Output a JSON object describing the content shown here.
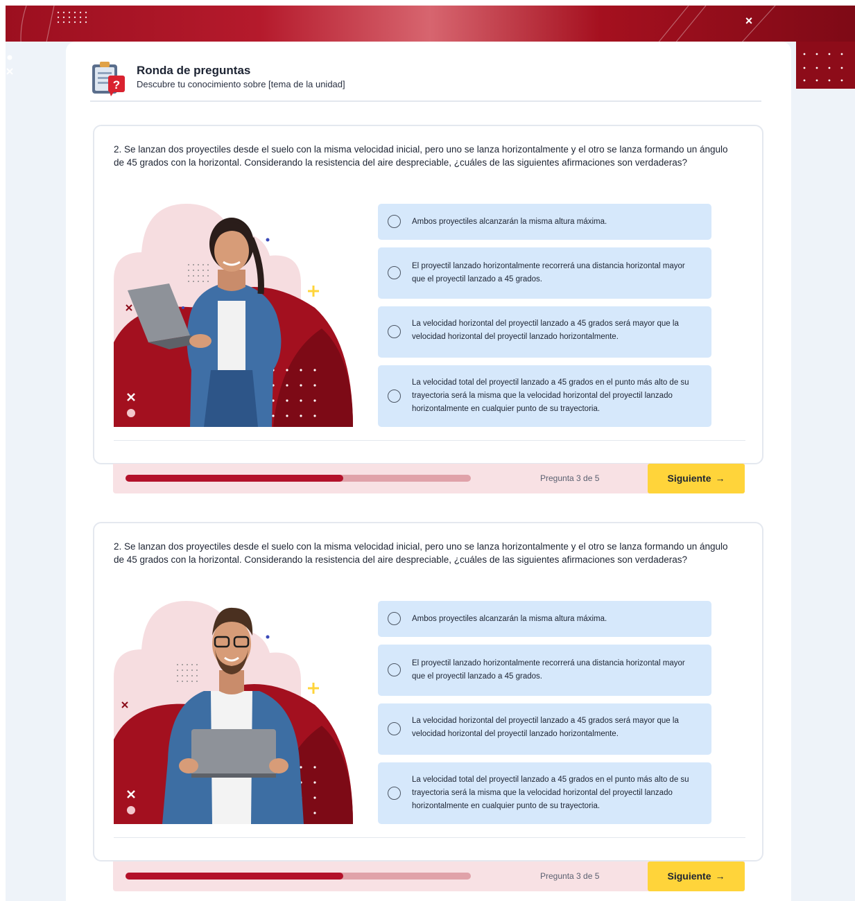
{
  "header": {
    "title": "Ronda de preguntas",
    "subtitle": "Descubre tu conocimiento sobre [tema de la unidad]"
  },
  "questions": [
    {
      "text": "2. Se lanzan dos proyectiles desde el suelo con la misma velocidad inicial, pero uno se lanza horizontalmente y el otro se lanza formando un ángulo de 45 grados con la horizontal. Considerando la resistencia del aire despreciable, ¿cuáles de las siguientes afirmaciones son verdaderas?",
      "options": [
        "Ambos proyectiles alcanzarán la misma altura máxima.",
        "El proyectil lanzado horizontalmente recorrerá una distancia horizontal mayor que el proyectil lanzado a 45 grados.",
        "La velocidad horizontal del proyectil lanzado a 45 grados será mayor que la velocidad horizontal del proyectil lanzado horizontalmente.",
        "La velocidad total del proyectil lanzado a 45 grados en el punto más alto de su trayectoria será la misma que la velocidad horizontal del proyectil lanzado horizontalmente en cualquier punto de su trayectoria."
      ],
      "progress_label": "Pregunta 3 de 5",
      "progress_fraction": 0.63,
      "next_label": "Siguiente",
      "next_arrow": "→"
    },
    {
      "text": "2. Se lanzan dos proyectiles desde el suelo con la misma velocidad inicial, pero uno se lanza horizontalmente y el otro se lanza formando un ángulo de 45 grados con la horizontal. Considerando la resistencia del aire despreciable, ¿cuáles de las siguientes afirmaciones son verdaderas?",
      "options": [
        "Ambos proyectiles alcanzarán la misma altura máxima.",
        "El proyectil lanzado horizontalmente recorrerá una distancia horizontal mayor que el proyectil lanzado a 45 grados.",
        "La velocidad horizontal del proyectil lanzado a 45 grados será mayor que la velocidad horizontal del proyectil lanzado horizontalmente.",
        "La velocidad total del proyectil lanzado a 45 grados en el punto más alto de su trayectoria será la misma que la velocidad horizontal del proyectil lanzado horizontalmente en cualquier punto de su trayectoria."
      ],
      "progress_label": "Pregunta 3 de 5",
      "progress_fraction": 0.63,
      "next_label": "Siguiente",
      "next_arrow": "→"
    }
  ],
  "colors": {
    "brand_red": "#b3112a",
    "option_bg": "#d6e8fb",
    "next_button": "#ffd43a",
    "footer_bg": "#f8e1e4"
  },
  "icons": {
    "banner_close": "×",
    "header": "clipboard-question-icon"
  }
}
